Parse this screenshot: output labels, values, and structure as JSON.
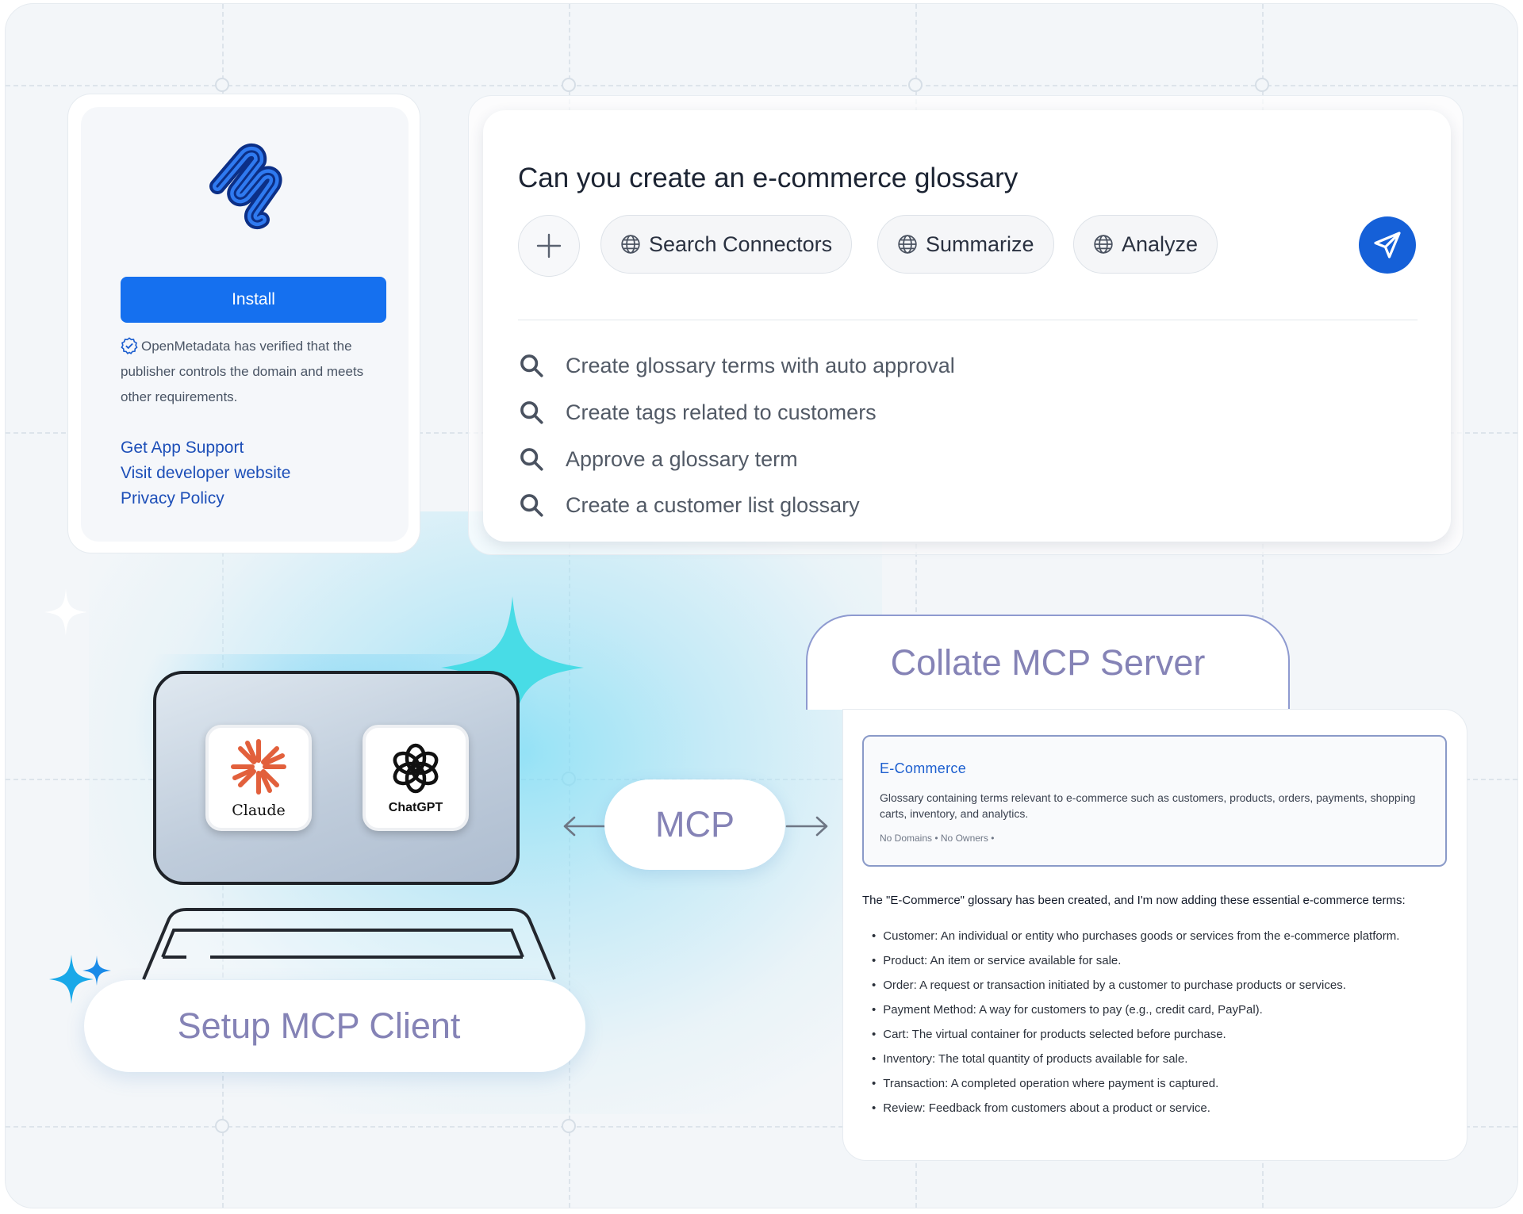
{
  "install_card": {
    "install_label": "Install",
    "verified_text": "OpenMetadata has verified that the publisher controls the domain and meets other requirements.",
    "links": [
      "Get App Support",
      "Visit developer website",
      "Privacy Policy"
    ]
  },
  "chat": {
    "prompt": "Can you create an e-commerce glossary",
    "actions": [
      "Search Connectors",
      "Summarize",
      "Analyze"
    ],
    "suggestions": [
      "Create glossary terms with auto approval",
      "Create tags related to customers",
      "Approve a glossary term",
      "Create a customer list glossary"
    ]
  },
  "client": {
    "apps": [
      "Claude",
      "ChatGPT"
    ],
    "setup_label": "Setup MCP Client"
  },
  "protocol": {
    "label": "MCP"
  },
  "server": {
    "title": "Collate MCP Server",
    "glossary": {
      "name": "E-Commerce",
      "description": "Glossary containing terms relevant to e-commerce such as customers, products, orders, payments, shopping carts, inventory, and analytics.",
      "meta": "No Domains • No Owners •"
    },
    "created_message": "The \"E-Commerce\" glossary has been created, and I'm now adding these essential e-commerce terms:",
    "terms": [
      "Customer: An individual or entity who purchases goods or services from the e-commerce platform.",
      "Product: An item or service available for sale.",
      "Order: A request or transaction initiated by a customer to purchase products or services.",
      "Payment Method: A way for customers to pay (e.g., credit card, PayPal).",
      "Cart: The virtual container for products selected before purchase.",
      "Inventory: The total quantity of products available for sale.",
      "Transaction: A completed operation where payment is captured.",
      "Review: Feedback from customers about a product or service."
    ]
  },
  "colors": {
    "accent": "#1570ef",
    "send": "#1560d8",
    "label": "#8583b6",
    "link": "#1d4fb8"
  },
  "icons": [
    "openmetadata-logo-icon",
    "verified-check-icon",
    "plus-icon",
    "globe-icon",
    "send-icon",
    "search-icon",
    "claude-icon",
    "chatgpt-icon",
    "arrow-left-icon",
    "arrow-right-icon",
    "sparkle-icon"
  ]
}
